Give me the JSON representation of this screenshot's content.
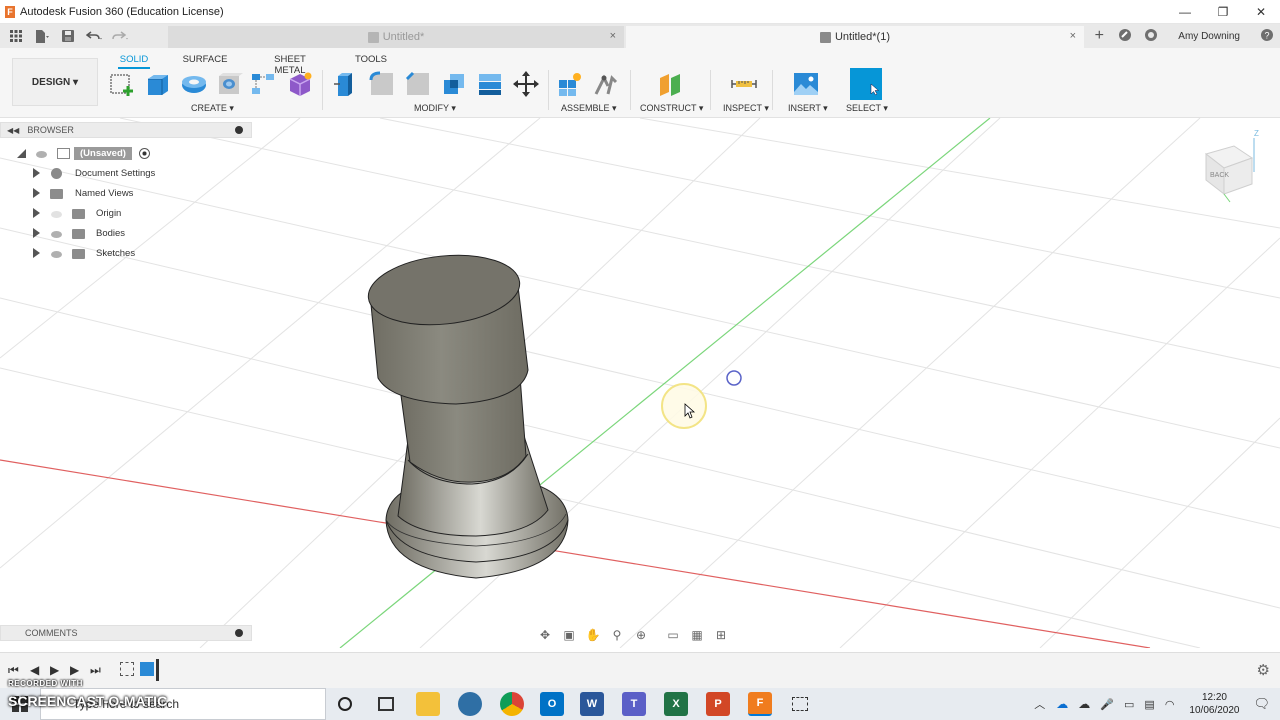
{
  "window": {
    "title": "Autodesk Fusion 360 (Education License)",
    "controls": [
      "—",
      "❐",
      "✕"
    ]
  },
  "tabs": {
    "inactive_label": "Untitled*",
    "active_label": "Untitled*(1)",
    "close_glyph": "×",
    "add_glyph": "+",
    "user": "Amy Downing"
  },
  "toolbar": {
    "design_label": "DESIGN ▾",
    "workspace_tabs": [
      "SOLID",
      "SURFACE",
      "SHEET METAL",
      "TOOLS"
    ],
    "groups": {
      "create": "CREATE ▾",
      "modify": "MODIFY ▾",
      "assemble": "ASSEMBLE ▾",
      "construct": "CONSTRUCT ▾",
      "inspect": "INSPECT ▾",
      "insert": "INSERT ▾",
      "select": "SELECT ▾"
    }
  },
  "browser": {
    "header": "BROWSER",
    "root": "(Unsaved)",
    "items": [
      "Document Settings",
      "Named Views",
      "Origin",
      "Bodies",
      "Sketches"
    ]
  },
  "comments": {
    "header": "COMMENTS"
  },
  "viewcube": {
    "face_label": "BACK",
    "axis_label": "Z"
  },
  "taskbar": {
    "search_placeholder": "Type here to search",
    "time": "12:20",
    "date": "10/06/2020",
    "apps": [
      {
        "name": "word",
        "letter": "W",
        "color": "#2b579a"
      },
      {
        "name": "teams",
        "letter": "T",
        "color": "#5b5fc7"
      },
      {
        "name": "excel",
        "letter": "X",
        "color": "#217346"
      },
      {
        "name": "powerpoint",
        "letter": "P",
        "color": "#d24726"
      },
      {
        "name": "fusion",
        "letter": "F",
        "color": "#f07c1e"
      }
    ]
  },
  "watermark": {
    "line1": "RECORDED WITH",
    "line2": "SCREENCAST-O-MATIC"
  },
  "colors": {
    "accent": "#0696d7",
    "fusion_orange": "#e8742e",
    "model_body": "#7c7a6f",
    "x_axis": "#e06060",
    "y_axis": "#7bd67b"
  }
}
